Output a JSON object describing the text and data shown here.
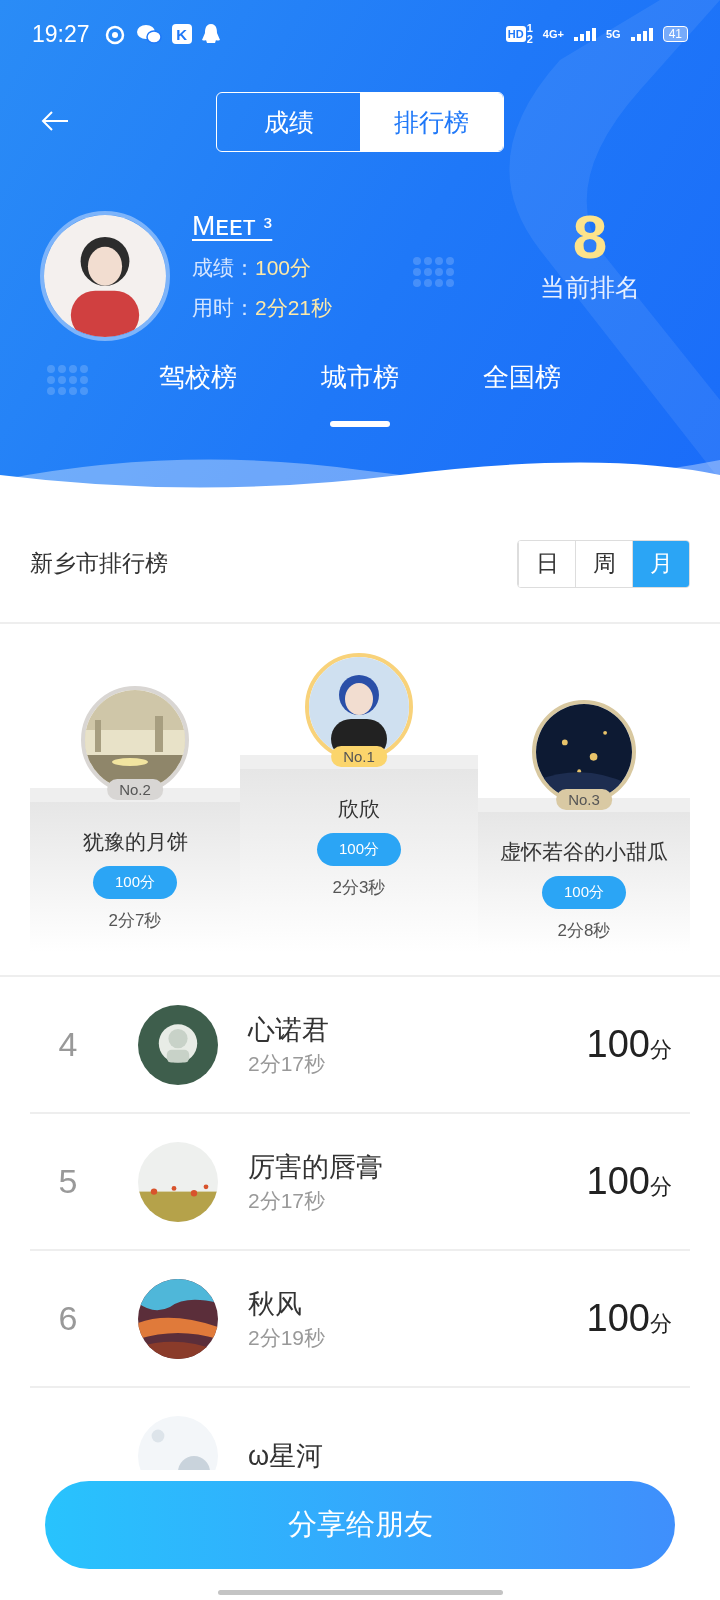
{
  "status_bar": {
    "time": "19:27",
    "app_letter": "K",
    "hd": "HD",
    "hd_sup": "1",
    "hd_sub": "2",
    "network_1": "4G+",
    "network_2": "5G",
    "battery": "41"
  },
  "view_tabs": [
    {
      "label": "成绩",
      "selected": false
    },
    {
      "label": "排行榜",
      "selected": true
    }
  ],
  "profile": {
    "name": "Mᴇᴇᴛ ᵌ",
    "score_label": "成绩：",
    "score": "100分",
    "time_label": "用时：",
    "time": "2分21秒",
    "rank": "8",
    "rank_label": "当前排名"
  },
  "board_tabs": [
    {
      "label": "驾校榜",
      "selected": false
    },
    {
      "label": "城市榜",
      "selected": true
    },
    {
      "label": "全国榜",
      "selected": false
    }
  ],
  "section": {
    "title": "新乡市排行榜",
    "periods": [
      {
        "label": "日",
        "selected": false
      },
      {
        "label": "周",
        "selected": false
      },
      {
        "label": "月",
        "selected": true
      }
    ]
  },
  "podium": [
    {
      "kind": "second",
      "place": "No.2",
      "name": "犹豫的月饼",
      "score": "100分",
      "time": "2分7秒"
    },
    {
      "kind": "first",
      "place": "No.1",
      "name": "欣欣",
      "score": "100分",
      "time": "2分3秒"
    },
    {
      "kind": "third",
      "place": "No.3",
      "name": "虚怀若谷的小甜瓜",
      "score": "100分",
      "time": "2分8秒"
    }
  ],
  "ranking": [
    {
      "rank": "4",
      "name": "心诺君",
      "time": "2分17秒",
      "score": "100",
      "unit": "分"
    },
    {
      "rank": "5",
      "name": "厉害的唇膏",
      "time": "2分17秒",
      "score": "100",
      "unit": "分"
    },
    {
      "rank": "6",
      "name": "秋风",
      "time": "2分19秒",
      "score": "100",
      "unit": "分"
    },
    {
      "name": "ω星河"
    }
  ],
  "share_button": "分享给朋友"
}
